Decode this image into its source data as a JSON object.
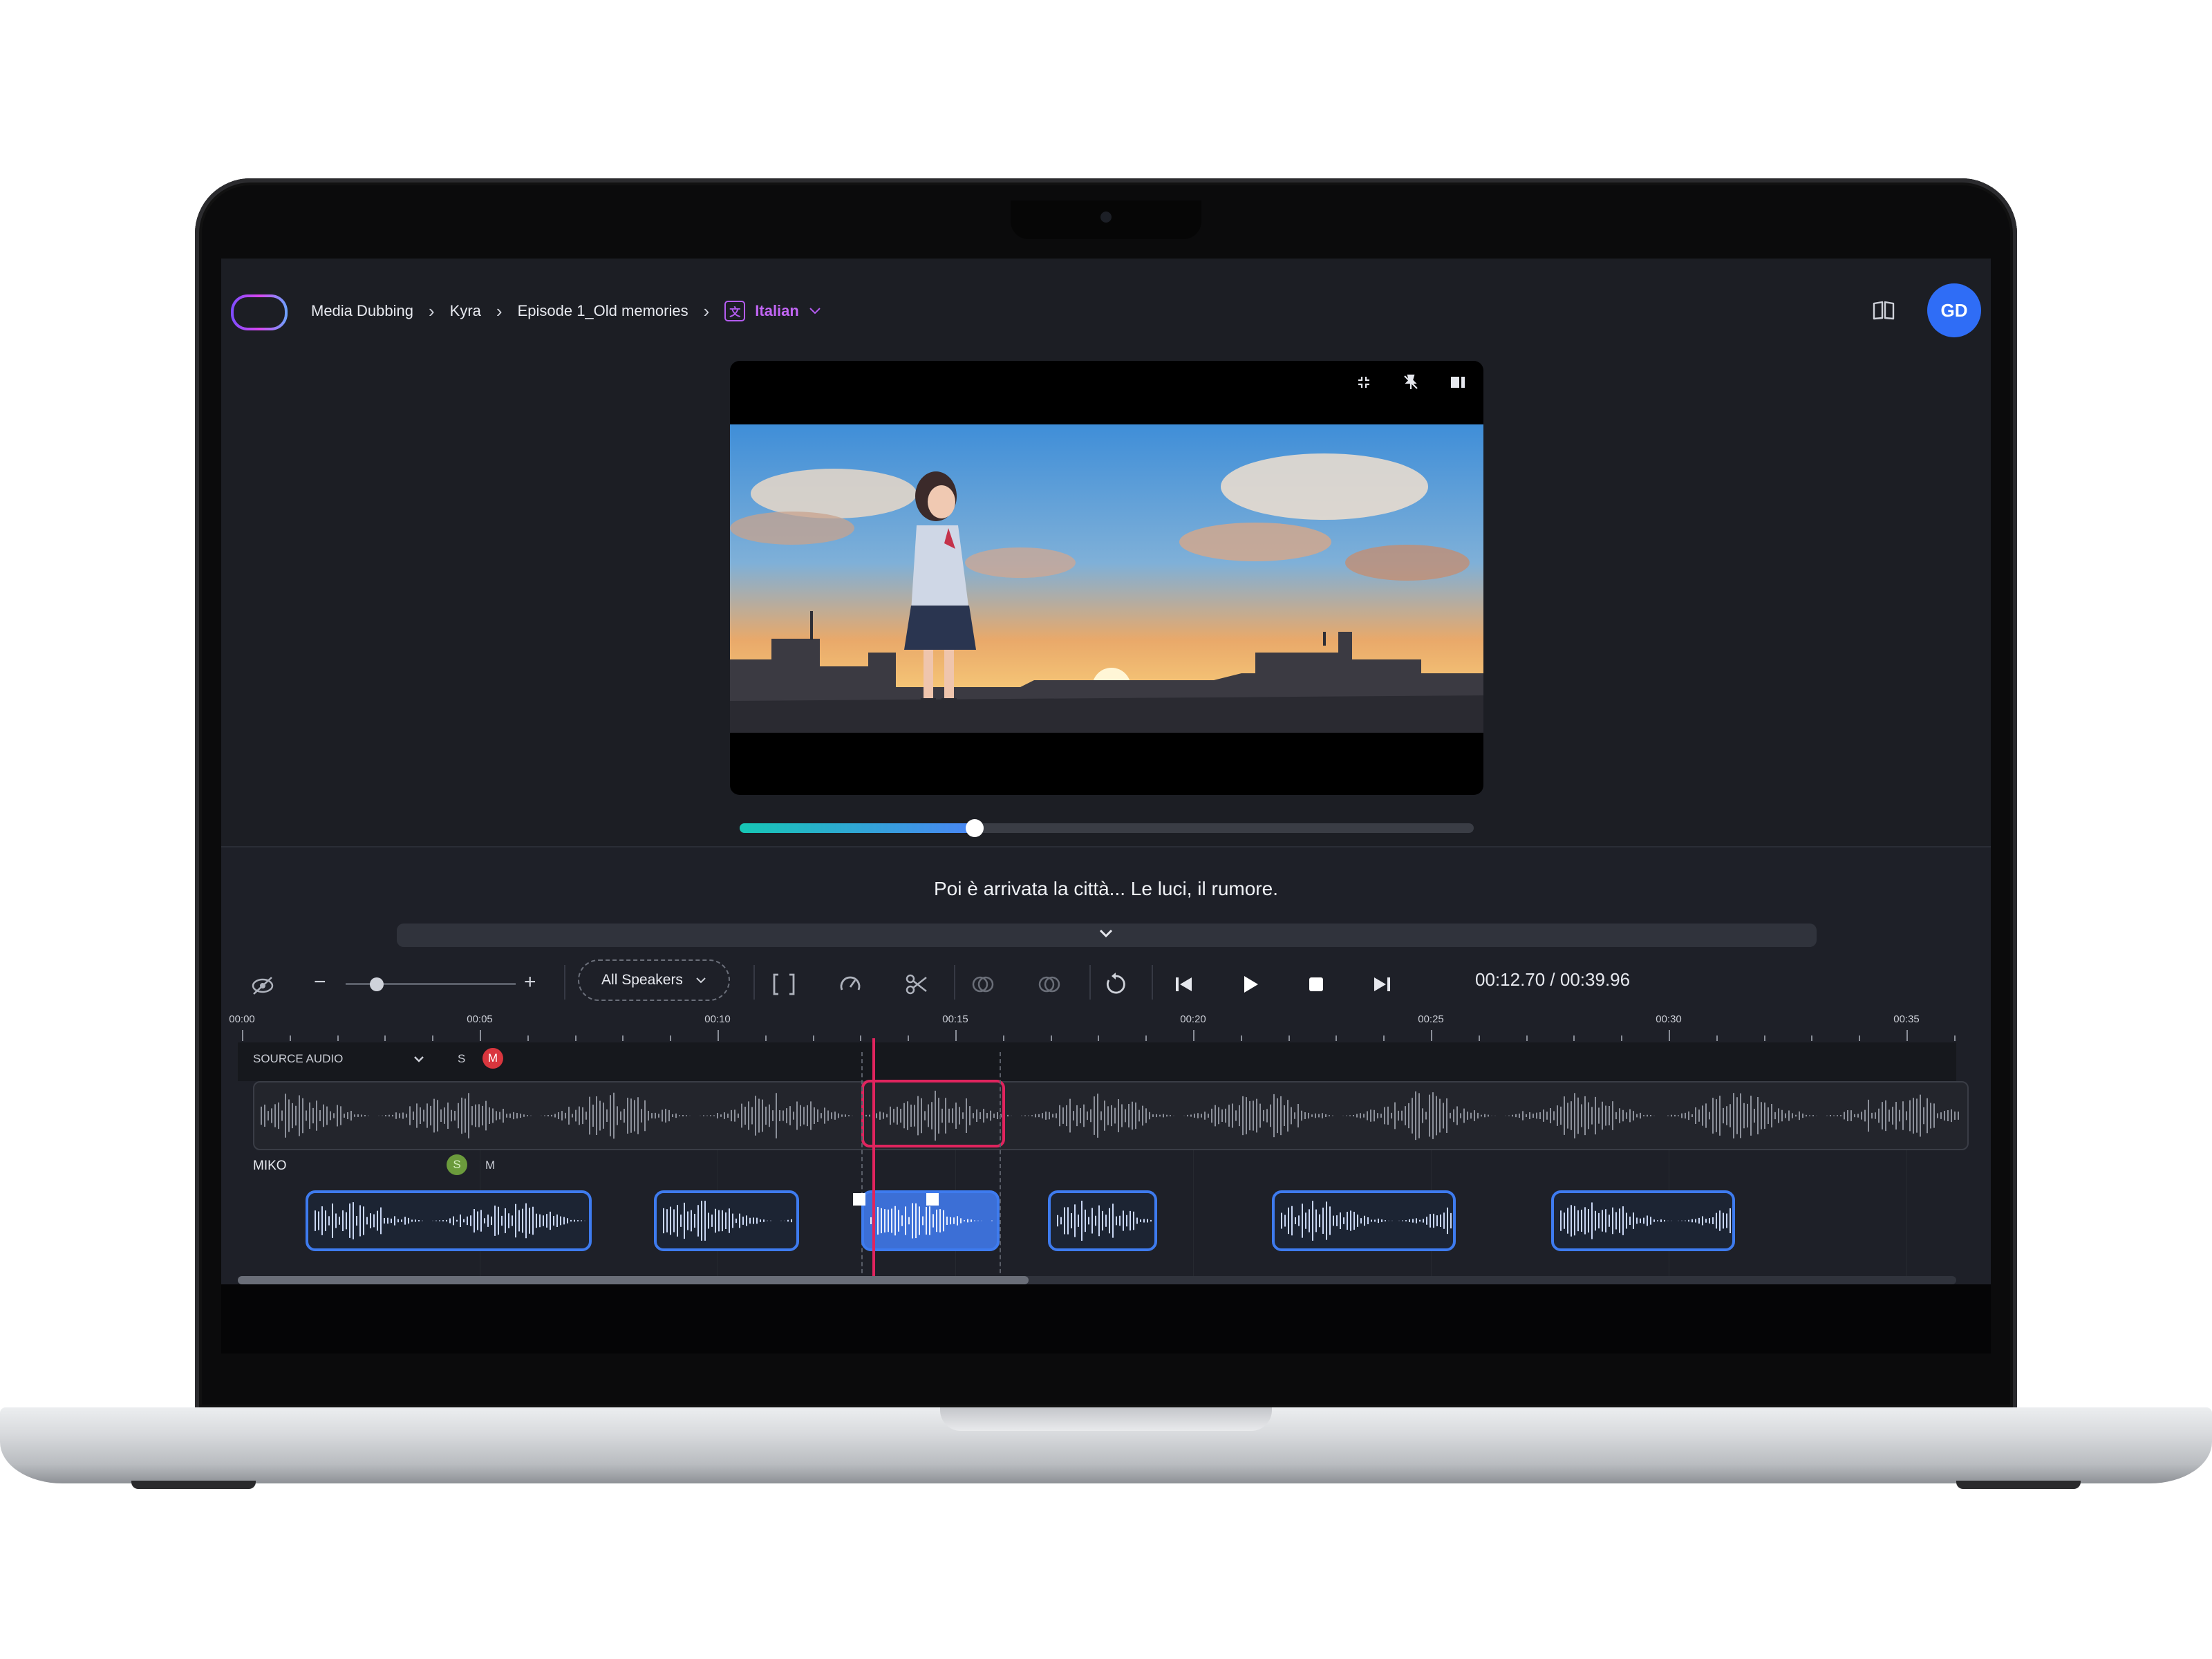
{
  "breadcrumb": {
    "items": [
      "Media Dubbing",
      "Kyra",
      "Episode 1_Old memories"
    ],
    "language": "Italian"
  },
  "user": {
    "initials": "GD"
  },
  "colors": {
    "accent": "#c266f5",
    "avatar": "#2f6df6",
    "progress_start": "#16c7b5",
    "progress_end": "#4a86f5",
    "playhead": "#e0245e",
    "clip_border": "#3e7bef"
  },
  "icons": {
    "player_tools": [
      "collapse-icon",
      "pin-icon",
      "panel-icon"
    ],
    "top_right": [
      "book-icon"
    ]
  },
  "video": {
    "progress_fraction": 0.32
  },
  "subtitle": {
    "text": "Poi è arrivata la città... Le luci, il rumore."
  },
  "toolbar": {
    "speakers_label": "All Speakers",
    "zoom_fraction": 0.06,
    "timecode": "00:12.70 / 00:39.96"
  },
  "timeline": {
    "ruler_labels": [
      "00:00",
      "00:05",
      "00:10",
      "00:15",
      "00:20",
      "00:25",
      "00:30",
      "00:35"
    ],
    "source_track": {
      "label": "SOURCE AUDIO",
      "solo": "S",
      "mute": "M"
    },
    "speaker_track": {
      "label": "MIKO",
      "solo": "S",
      "mute": "M"
    }
  }
}
